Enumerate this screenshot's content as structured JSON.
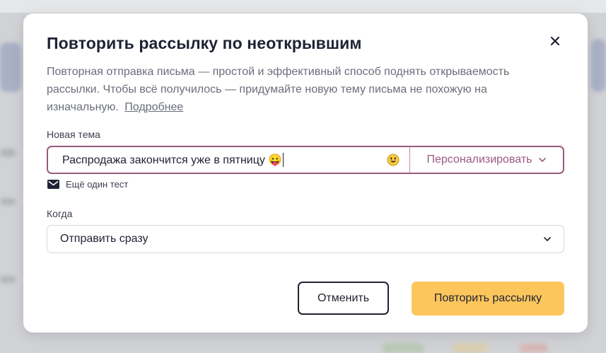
{
  "dialog": {
    "title": "Повторить рассылку по неоткрывшим",
    "description": "Повторная отправка письма — простой и эффективный способ поднять открываемость рассылки. Чтобы всё получилось — придумайте новую тему письма не похожую на изначальную.",
    "more_link": "Подробнее",
    "close_icon": "close-icon"
  },
  "subject": {
    "label": "Новая тема",
    "value": "Распродажа закончится уже в пятницу 😛",
    "emoji_icon": "smiley-icon",
    "personalize_label": "Персонализировать",
    "personalize_icon": "chevron-down-icon"
  },
  "test": {
    "label": "Ещё один тест",
    "icon": "envelope-icon"
  },
  "when": {
    "label": "Когда",
    "selected": "Отправить сразу",
    "icon": "chevron-down-icon"
  },
  "buttons": {
    "cancel": "Отменить",
    "repeat": "Повторить рассылку"
  },
  "colors": {
    "accent": "#9a5a7e",
    "primary_button": "#fdc65c",
    "text": "#1f2233",
    "muted": "#6b6e7b"
  }
}
